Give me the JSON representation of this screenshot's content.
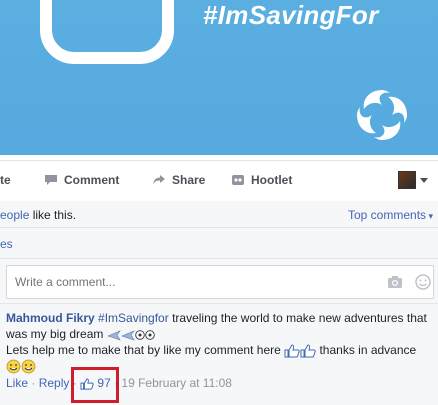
{
  "banner": {
    "hashtag": "#ImSavingFor"
  },
  "actions": {
    "like_label_partial": "te",
    "comment_label": "Comment",
    "share_label": "Share",
    "hootlet_label": "Hootlet"
  },
  "likes_summary": {
    "people_partial": "eople",
    "suffix": " like this.",
    "top_comments": "Top comments"
  },
  "replies_partial": "es",
  "write_comment": {
    "placeholder": "Write a comment..."
  },
  "comment": {
    "author": "Mahmoud Fikry",
    "hashtag": "#ImSavingfor",
    "text1": " traveling the world to make new adventures that was my big dream ",
    "text2": "Lets help me to make that by like my comment here ",
    "text3": " thanks in advance",
    "like_link": "Like",
    "sep1": " · ",
    "reply_link": "Reply",
    "sep2": " · ",
    "like_count": "97",
    "sep3": " · ",
    "timestamp": "19 February at 11:08"
  },
  "colors": {
    "banner": "#56aadf",
    "link": "#4267b2",
    "highlight": "#cc1f2b"
  },
  "icons": [
    "comment-icon",
    "share-icon",
    "hootlet-icon",
    "camera-icon",
    "emoji-icon",
    "thumbs-up-icon",
    "airplane-icon",
    "soccer-ball-icon",
    "smiley-icon"
  ]
}
